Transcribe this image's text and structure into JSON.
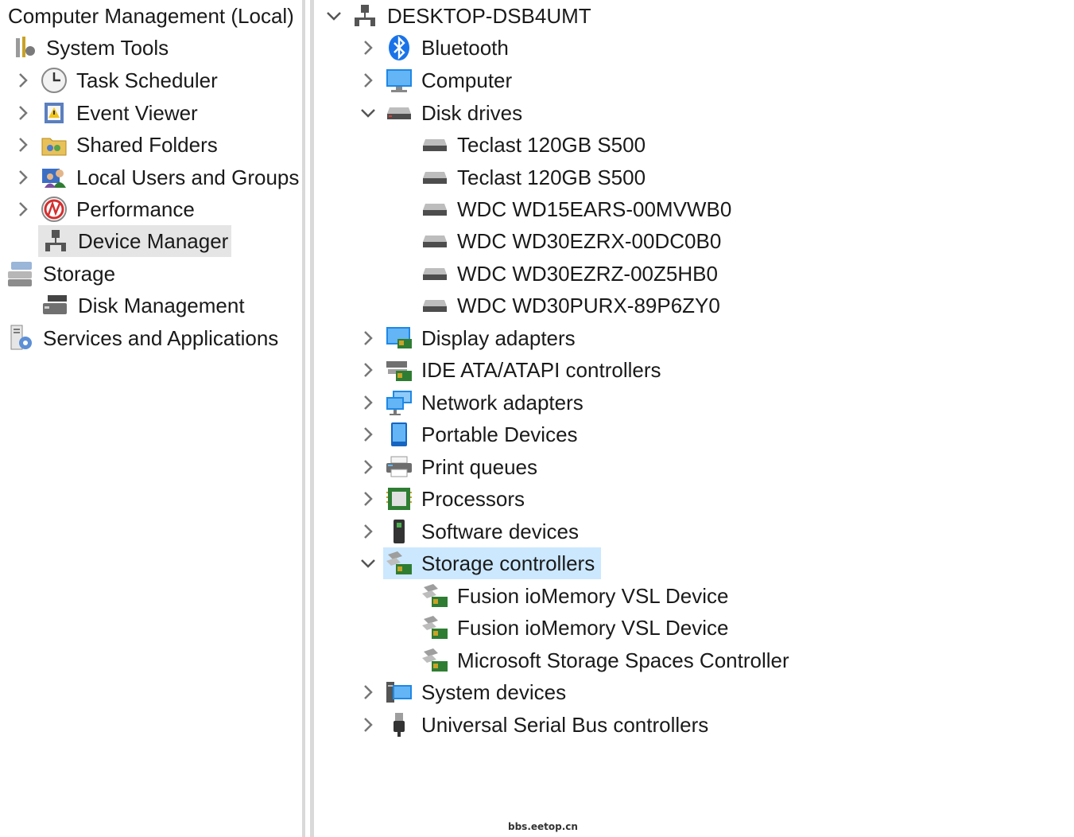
{
  "left_tree": {
    "root": "Computer Management (Local)",
    "system_tools": "System Tools",
    "task_scheduler": "Task Scheduler",
    "event_viewer": "Event Viewer",
    "shared_folders": "Shared Folders",
    "local_users": "Local Users and Groups",
    "performance": "Performance",
    "device_manager": "Device Manager",
    "storage": "Storage",
    "disk_management": "Disk Management",
    "services": "Services and Applications"
  },
  "device_tree": {
    "computer_name": "DESKTOP-DSB4UMT",
    "bluetooth": "Bluetooth",
    "computer": "Computer",
    "disk_drives": "Disk drives",
    "disks": [
      "Teclast 120GB S500",
      "Teclast 120GB S500",
      "WDC WD15EARS-00MVWB0",
      "WDC WD30EZRX-00DC0B0",
      "WDC WD30EZRZ-00Z5HB0",
      "WDC WD30PURX-89P6ZY0"
    ],
    "display_adapters": "Display adapters",
    "ide_controllers": "IDE ATA/ATAPI controllers",
    "network_adapters": "Network adapters",
    "portable_devices": "Portable Devices",
    "print_queues": "Print queues",
    "processors": "Processors",
    "software_devices": "Software devices",
    "storage_controllers": "Storage controllers",
    "storage_children": [
      "Fusion ioMemory VSL Device",
      "Fusion ioMemory VSL Device",
      "Microsoft Storage Spaces Controller"
    ],
    "system_devices": "System devices",
    "usb_controllers": "Universal Serial Bus controllers"
  },
  "watermark": "bbs.eetop.cn",
  "colors": {
    "selection_blue": "#cce8ff",
    "selection_gray": "#e5e5e5",
    "separator": "#d9d9d9"
  }
}
